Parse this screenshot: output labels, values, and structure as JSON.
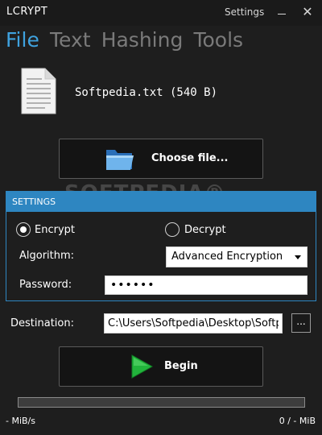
{
  "window": {
    "title": "LCRYPT",
    "settings_label": "Settings",
    "close_glyph": "✕"
  },
  "tabs": [
    {
      "label": "File",
      "active": true
    },
    {
      "label": "Text",
      "active": false
    },
    {
      "label": "Hashing",
      "active": false
    },
    {
      "label": "Tools",
      "active": false
    }
  ],
  "file": {
    "name_display": "Softpedia.txt (540 B)",
    "icon": "document-icon"
  },
  "choose_file": {
    "label": "Choose file...",
    "icon": "folder-icon"
  },
  "watermark": "SOFTPEDIA®",
  "settings": {
    "title": "SETTINGS",
    "mode_options": [
      {
        "label": "Encrypt",
        "selected": true
      },
      {
        "label": "Decrypt",
        "selected": false
      }
    ],
    "algorithm_label": "Algorithm:",
    "algorithm_value": "Advanced Encryption Standard",
    "password_label": "Password:",
    "password_value": "••••••"
  },
  "destination": {
    "label": "Destination:",
    "value": "C:\\Users\\Softpedia\\Desktop\\Softpedia.txt",
    "browse_label": "..."
  },
  "begin": {
    "label": "Begin",
    "icon": "play-icon"
  },
  "progress": {
    "value": 0,
    "speed_text": "- MiB/s",
    "size_text": "0 / - MiB"
  },
  "colors": {
    "accent": "#2e86c1",
    "active_tab": "#3fa2df",
    "background": "#1e1e1e",
    "play_green": "#22b43c"
  }
}
